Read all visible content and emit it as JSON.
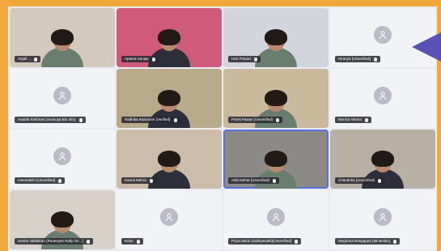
{
  "participants": [
    {
      "name": "Anjali ...",
      "type": "video",
      "bg": "#d4c9bd"
    },
    {
      "name": "Aparna Sanjay",
      "type": "video",
      "bg": "#cf5a7a"
    },
    {
      "name": "Hari Prasad",
      "type": "video",
      "bg": "#d2d6dc"
    },
    {
      "name": "Hiranya (Unverified)",
      "type": "avatar"
    },
    {
      "name": "Ananth Krishnan (Anusuya Bio Info)",
      "type": "avatar"
    },
    {
      "name": "Radhika Ramanan (Verified)",
      "type": "video",
      "bg": "#b8aa8a"
    },
    {
      "name": "Preeti Pawan (Unverified)",
      "type": "video",
      "bg": "#cbb99e"
    },
    {
      "name": "Monica Verma",
      "type": "avatar"
    },
    {
      "name": "meenakshi (Unverified)",
      "type": "avatar"
    },
    {
      "name": "Kamal Mehra",
      "type": "video",
      "bg": "#cdbcaa"
    },
    {
      "name": "Aditi Mehta (Unverified)",
      "type": "video",
      "bg": "#8b8a86"
    },
    {
      "name": "Chandrika (Unverified)",
      "type": "video",
      "bg": "#b8b0a4"
    },
    {
      "name": "Harika Vallabhan (Raveeyan Rally Ori...)",
      "type": "video",
      "bg": "#d8d1c9"
    },
    {
      "name": "Kuttu",
      "type": "avatar"
    },
    {
      "name": "Priya Naidu (Sathyavathi)(Unverified)",
      "type": "avatar"
    },
    {
      "name": "Meghana Rangappa (Minamiku)",
      "type": "avatar"
    }
  ],
  "colors": {
    "frame": "#f2a93b",
    "accent": "#5b6ee0",
    "arrow": "#5a4fb3"
  }
}
